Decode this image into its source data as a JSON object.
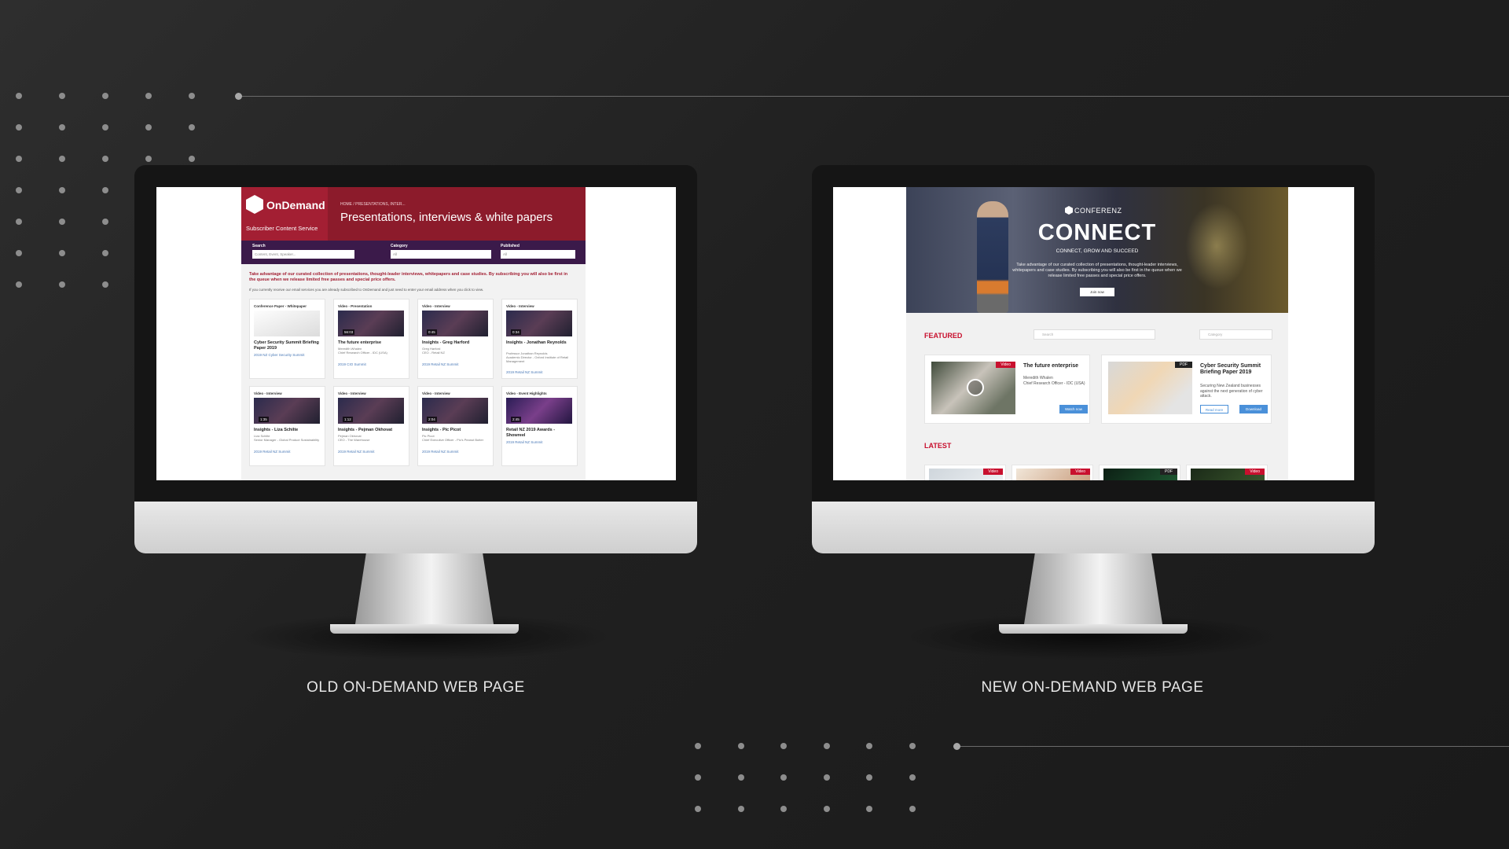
{
  "captions": {
    "left": "OLD ON-DEMAND WEB PAGE",
    "right": "NEW ON-DEMAND WEB PAGE"
  },
  "old_page": {
    "logo_name": "OnDemand",
    "logo_sub": "Subscriber Content Service",
    "breadcrumb": "HOME / PRESENTATIONS, INTER...",
    "title": "Presentations, interviews & white papers",
    "filters": {
      "search_label": "Search",
      "search_placeholder": "Content, Event, Speaker...",
      "category_label": "Category",
      "category_value": "All",
      "published_label": "Published",
      "published_value": "All"
    },
    "intro": "Take advantage of our curated collection of presentations, thought-leader interviews, whitepapers and case studies. By subscribing you will also be first in the queue when we release limited free passes and special price offers.",
    "intro_note": "If you currently receive our email services you are already subscribed to OnDemand and just need to enter your email address when you click to view.",
    "cards": [
      {
        "type": "Conference Paper - Whitepaper",
        "duration": "",
        "title": "Cyber Security Summit Briefing Paper 2019",
        "meta": "",
        "event": "2019 NZ Cyber Security Summit"
      },
      {
        "type": "Video - Presentation",
        "duration": "56:03",
        "title": "The future enterprise",
        "meta": "Meredith Whalen\nChief Research Officer - IDC (USA)",
        "event": "2019 CIO Summit"
      },
      {
        "type": "Video - Interview",
        "duration": "0:45",
        "title": "Insights - Greg Harford",
        "meta": "Greg Harford\nCEO - Retail NZ",
        "event": "2019 Retail NZ Summit"
      },
      {
        "type": "Video - Interview",
        "duration": "0:34",
        "title": "Insights - Jonathan Reynolds",
        "meta": "Professor Jonathan Reynolds\nAcademic Director - Oxford Institute of Retail Management",
        "event": "2019 Retail NZ Summit"
      },
      {
        "type": "Video - Interview",
        "duration": "1:35",
        "title": "Insights - Liza Schilte",
        "meta": "Liza Schilte\nSenior Manager - Global Product Sustainability",
        "event": "2019 Retail NZ Summit"
      },
      {
        "type": "Video - Interview",
        "duration": "1:12",
        "title": "Insights - Pejman Okhovat",
        "meta": "Pejman Okhovat\nCEO - The Warehouse",
        "event": "2019 Retail NZ Summit"
      },
      {
        "type": "Video - Interview",
        "duration": "2:04",
        "title": "Insights - Pic Picot",
        "meta": "Pic Picot\nChief Executive Officer - Pic's Peanut Butter",
        "event": "2019 Retail NZ Summit"
      },
      {
        "type": "Video - Event Highlights",
        "duration": "2:45",
        "title": "Retail NZ 2019 Awards - Showreel",
        "meta": "",
        "event": "2019 Retail NZ Summit"
      }
    ]
  },
  "new_page": {
    "brand": "CONFERENZ",
    "hero_title": "CONNECT",
    "hero_tagline": "CONNECT, GROW AND SUCCEED",
    "hero_text": "Take advantage of our curated collection of presentations, thought-leader interviews, whitepapers and case studies. By subscribing you will also be first in the queue when we release limited free passes and special price offers.",
    "hero_button": "Join now",
    "featured_label": "FEATURED",
    "search_placeholder": "Search",
    "category_placeholder": "Category",
    "latest_label": "LATEST",
    "featured": [
      {
        "badge": "Video",
        "title": "The future enterprise",
        "meta": "Meredith Whalen\nChief Research Officer - IDC (USA)",
        "button1": "Watch now",
        "button2": ""
      },
      {
        "badge": "PDF",
        "title": "Cyber Security Summit Briefing Paper 2019",
        "meta": "Securing New Zealand businesses against the next generation of cyber attack.",
        "button1": "Read more",
        "button2": "Download"
      }
    ],
    "latest": [
      {
        "badge": "Video"
      },
      {
        "badge": "Video"
      },
      {
        "badge": "PDF"
      },
      {
        "badge": "Video"
      }
    ]
  },
  "colors": {
    "old_brand": "#8c1b2b",
    "old_filter_bar": "#3b1a4a",
    "new_accent": "#c8102e",
    "new_button": "#4a90d9"
  }
}
